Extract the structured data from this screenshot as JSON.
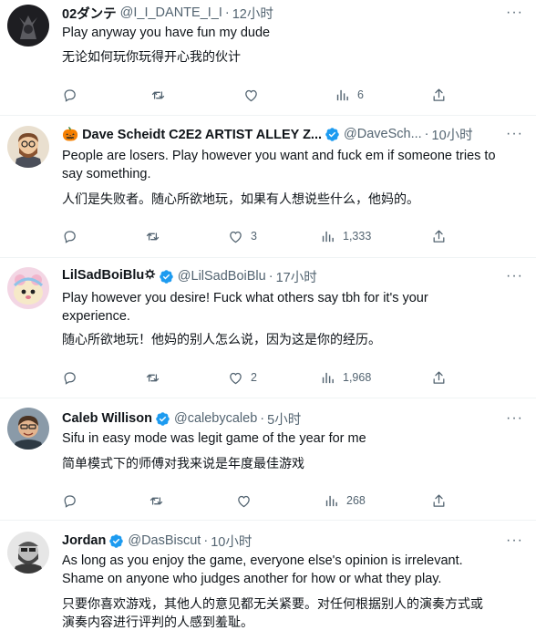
{
  "tweets": [
    {
      "name": "02ダンテ",
      "handle": "@I_I_DANTE_I_I",
      "time": "12小时",
      "verified": false,
      "text": [
        "Play anyway you have fun my dude"
      ],
      "translation": [
        "无论如何玩你玩得开心我的伙计"
      ],
      "replies": "",
      "retweets": "",
      "likes": "",
      "views": "6"
    },
    {
      "name": "🎃 Dave Scheidt C2E2 ARTIST ALLEY Z...",
      "handle": "@DaveSch...",
      "time": "10小时",
      "verified": true,
      "text": [
        "People are losers. Play however you want and fuck em if someone tries to",
        "say something."
      ],
      "translation": [
        "人们是失败者。随心所欲地玩，如果有人想说些什么，他妈的。"
      ],
      "replies": "",
      "retweets": "",
      "likes": "3",
      "views": "1,333"
    },
    {
      "name": "LilSadBoiBlu🌣",
      "handle": "@LilSadBoiBlu",
      "time": "17小时",
      "verified": true,
      "text": [
        "Play however you desire! Fuck what others say tbh for it's your",
        "experience."
      ],
      "translation": [
        "随心所欲地玩！他妈的别人怎么说，因为这是你的经历。"
      ],
      "replies": "",
      "retweets": "",
      "likes": "2",
      "views": "1,968"
    },
    {
      "name": "Caleb Willison",
      "handle": "@calebycaleb",
      "time": "5小时",
      "verified": true,
      "text": [
        "Sifu in easy mode was legit game of the year for me"
      ],
      "translation": [
        "简单模式下的师傅对我来说是年度最佳游戏"
      ],
      "replies": "",
      "retweets": "",
      "likes": "",
      "views": "268"
    },
    {
      "name": "Jordan",
      "handle": "@DasBiscut",
      "time": "10小时",
      "verified": true,
      "text": [
        "As long as you enjoy the game, everyone else's opinion is irrelevant.",
        "Shame on anyone who judges another for how or what they play."
      ],
      "translation": [
        "只要你喜欢游戏，其他人的意见都无关紧要。对任何根据别人的演奏方式或",
        "演奏内容进行评判的人感到羞耻。"
      ],
      "replies": "",
      "retweets": "",
      "likes": "",
      "views": ""
    }
  ],
  "colors": {
    "text": "#0f1419",
    "muted": "#536471",
    "verified": "#1d9bf0",
    "divider": "#eff3f4"
  }
}
